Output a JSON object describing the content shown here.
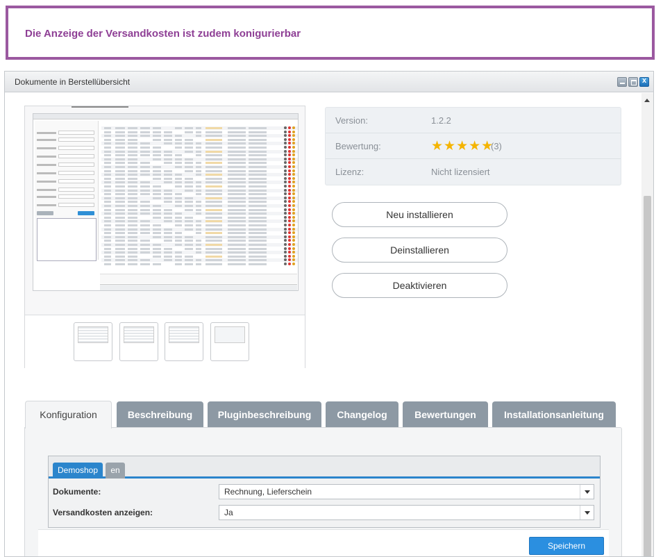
{
  "banner": {
    "text": "Die Anzeige der Versandkosten ist zudem konigurierbar"
  },
  "window": {
    "title": "Dokumente in Berstellübersicht",
    "controls": [
      "minimize-icon",
      "maximize-icon",
      "close-icon"
    ],
    "close_glyph": "x"
  },
  "plugin_info": {
    "version_label": "Version:",
    "version_value": "1.2.2",
    "rating_label": "Bewertung:",
    "rating_stars": "★★★★★",
    "rating_value": 5,
    "rating_count": "(3)",
    "license_label": "Lizenz:",
    "license_value": "Nicht lizensiert"
  },
  "actions": {
    "reinstall": "Neu installieren",
    "uninstall": "Deinstallieren",
    "deactivate": "Deaktivieren"
  },
  "tabs": [
    {
      "label": "Konfiguration",
      "active": true
    },
    {
      "label": "Beschreibung",
      "active": false
    },
    {
      "label": "Pluginbeschreibung",
      "active": false
    },
    {
      "label": "Changelog",
      "active": false
    },
    {
      "label": "Bewertungen",
      "active": false
    },
    {
      "label": "Installationsanleitung",
      "active": false
    }
  ],
  "config": {
    "shop_tabs": [
      "Demoshop",
      "en"
    ],
    "fields": [
      {
        "label": "Dokumente:",
        "value": "Rechnung, Lieferschein"
      },
      {
        "label": "Versandkosten anzeigen:",
        "value": "Ja"
      }
    ],
    "save_label": "Speichern"
  },
  "colors": {
    "banner_border": "#9b59a0",
    "banner_text": "#8e3f95",
    "accent": "#2b85cc",
    "star": "#f4b400",
    "tab_inactive": "#8d99a4"
  }
}
